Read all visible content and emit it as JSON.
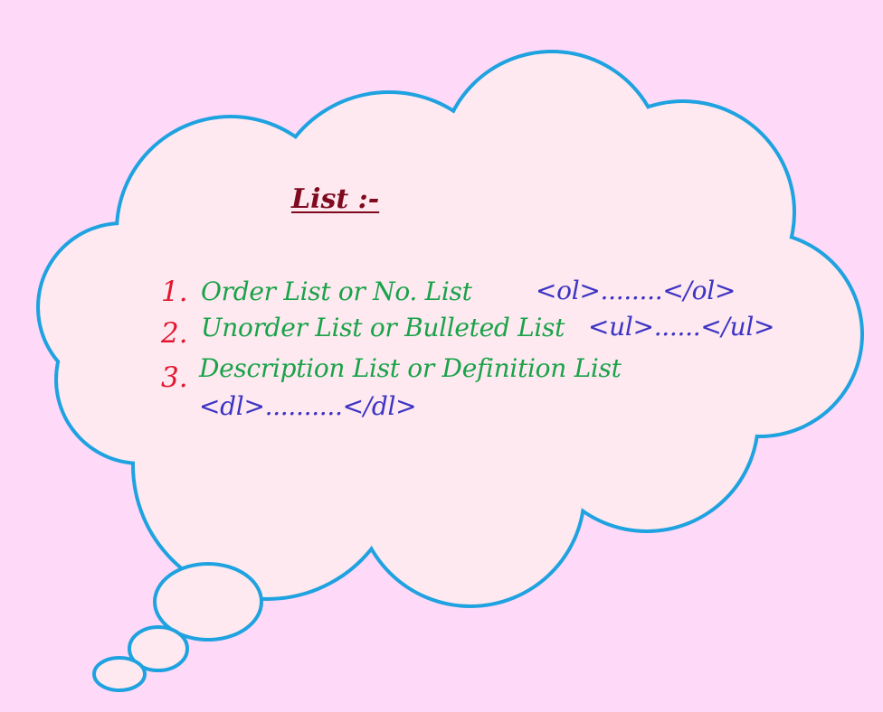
{
  "title": "List :-",
  "colors": {
    "background": "#FFD9F8",
    "cloud_fill": "#FDE9EF",
    "cloud_stroke": "#1FA2E0",
    "title": "#7F0A1F",
    "number": "#E4152F",
    "label": "#1AA24A",
    "tag": "#3C33C4"
  },
  "items": [
    {
      "number": "1.",
      "label": "Order List or No. List",
      "tag": "<ol>........</ol>"
    },
    {
      "number": "2.",
      "label": "Unorder List or Bulleted List",
      "tag": "<ul>......</ul>"
    },
    {
      "number": "3.",
      "label": "Description List or Definition List",
      "tag": "<dl>..........</dl>"
    }
  ]
}
